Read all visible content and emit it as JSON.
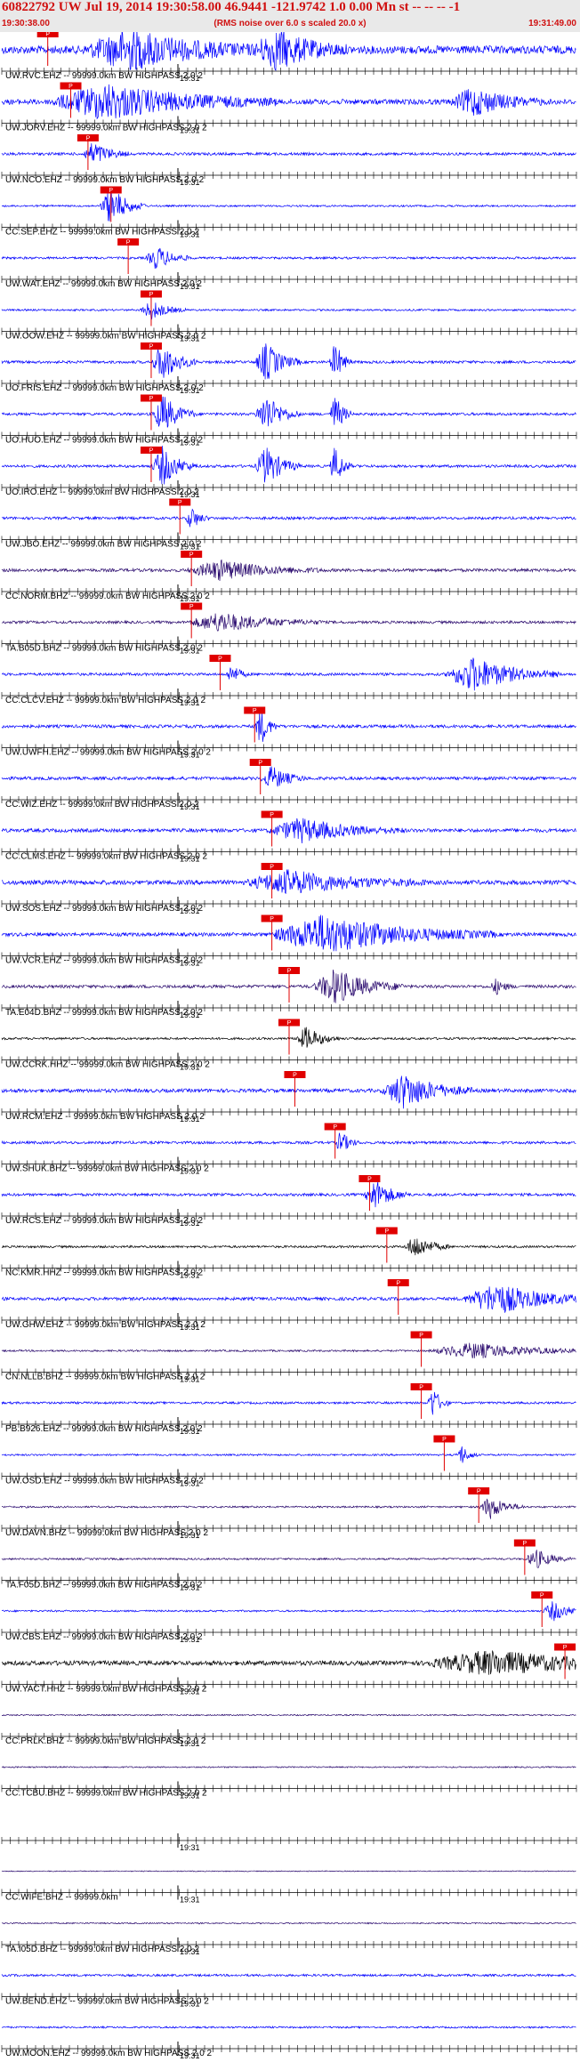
{
  "header": {
    "title": "60822792 UW Jul 19, 2014 19:30:58.00   46.9441 -121.9742  1.0 0.00 Mn st -- -- --  -1",
    "start_time": "19:30:38.00",
    "end_time": "19:31:49.00",
    "subtitle": "(RMS noise over 6.0 s scaled 20.0 x)"
  },
  "chart_data": {
    "type": "line",
    "title": "60822792 UW Jul 19, 2014 19:30:58.00   46.9441 -121.9742  1.0 0.00 Mn st -- -- --  -1",
    "subtitle": "(RMS noise over 6.0 s scaled 20.0 x)",
    "x_range": [
      "19:30:38.00",
      "19:31:49.00"
    ],
    "tick_label": "19:31",
    "pick_label": "P",
    "colors": {
      "blue": "#0000ff",
      "purple": "#2a0a6e",
      "black": "#000000",
      "pick": "#e00000"
    },
    "series": [
      {
        "label": "UW.RVC.EHZ -- 99999.0km BW  HIGHPASS  2.0  2",
        "color": "blue",
        "pick": 0.08,
        "amp": 0.9,
        "bursts": [
          [
            0.22,
            0.08,
            1.0
          ],
          [
            0.48,
            0.04,
            1.0
          ]
        ]
      },
      {
        "label": "UW.JORV.EHZ -- 99999.0km BW  HIGHPASS  2.0  2",
        "color": "blue",
        "pick": 0.12,
        "amp": 0.6,
        "bursts": [
          [
            0.18,
            0.1,
            0.9
          ],
          [
            0.82,
            0.04,
            0.7
          ]
        ]
      },
      {
        "label": "UW.NCO.EHZ -- 99999.0km BW  HIGHPASS  2.0  2",
        "color": "blue",
        "pick": 0.15,
        "amp": 0.3,
        "bursts": [
          [
            0.16,
            0.02,
            0.6
          ]
        ]
      },
      {
        "label": "CC.SEP.EHZ -- 99999.0km BW  HIGHPASS  2.0  2",
        "color": "blue",
        "pick": 0.19,
        "amp": 0.2,
        "bursts": [
          [
            0.19,
            0.02,
            1.0
          ]
        ]
      },
      {
        "label": "UW.WAT.EHZ -- 99999.0km BW  HIGHPASS  2.0  2",
        "color": "blue",
        "pick": 0.22,
        "amp": 0.25,
        "bursts": [
          [
            0.27,
            0.02,
            0.6
          ]
        ]
      },
      {
        "label": "UW.OOW.EHZ -- 99999.0km BW  HIGHPASS  2.0  2",
        "color": "blue",
        "pick": 0.26,
        "amp": 0.2,
        "bursts": [
          [
            0.26,
            0.02,
            0.5
          ]
        ]
      },
      {
        "label": "UO.FRIS.EHZ -- 99999.0km BW  HIGHPASS  2.0  2",
        "color": "blue",
        "pick": 0.26,
        "amp": 0.3,
        "bursts": [
          [
            0.28,
            0.02,
            1.0
          ],
          [
            0.46,
            0.02,
            1.0
          ],
          [
            0.58,
            0.01,
            1.0
          ]
        ]
      },
      {
        "label": "UO.HUO.EHZ -- 99999.0km BW  HIGHPASS  2.0  2",
        "color": "blue",
        "pick": 0.26,
        "amp": 0.3,
        "bursts": [
          [
            0.28,
            0.02,
            1.0
          ],
          [
            0.46,
            0.02,
            1.0
          ],
          [
            0.58,
            0.01,
            1.0
          ]
        ]
      },
      {
        "label": "UO.IRO.EHZ -- 99999.0km BW  HIGHPASS  2.0  2",
        "color": "blue",
        "pick": 0.26,
        "amp": 0.3,
        "bursts": [
          [
            0.28,
            0.02,
            1.0
          ],
          [
            0.46,
            0.02,
            1.0
          ],
          [
            0.58,
            0.01,
            1.0
          ]
        ]
      },
      {
        "label": "UW.JBO.EHZ -- 99999.0km BW  HIGHPASS  2.0  2",
        "color": "blue",
        "pick": 0.31,
        "amp": 0.3,
        "bursts": [
          [
            0.33,
            0.01,
            0.6
          ]
        ]
      },
      {
        "label": "CC.NORM.BHZ -- 99999.0km BW  HIGHPASS  2.0  2",
        "color": "purple",
        "pick": 0.33,
        "amp": 0.35,
        "bursts": [
          [
            0.38,
            0.06,
            0.5
          ]
        ]
      },
      {
        "label": "TA.B05D.BHZ -- 99999.0km BW  HIGHPASS  2.0  2",
        "color": "purple",
        "pick": 0.33,
        "amp": 0.3,
        "bursts": [
          [
            0.38,
            0.06,
            0.5
          ]
        ]
      },
      {
        "label": "CC.CLCV.EHZ -- 99999.0km BW  HIGHPASS  2.0  2",
        "color": "blue",
        "pick": 0.38,
        "amp": 0.3,
        "bursts": [
          [
            0.4,
            0.01,
            0.5
          ],
          [
            0.82,
            0.05,
            0.9
          ]
        ]
      },
      {
        "label": "UW.UWFH.EHZ -- 99999.0km BW  HIGHPASS  2.0  2",
        "color": "blue",
        "pick": 0.44,
        "amp": 0.35,
        "bursts": [
          [
            0.45,
            0.01,
            1.0
          ]
        ]
      },
      {
        "label": "CC.WIZ.EHZ -- 99999.0km BW  HIGHPASS  2.0  2",
        "color": "blue",
        "pick": 0.45,
        "amp": 0.35,
        "bursts": [
          [
            0.47,
            0.02,
            0.6
          ]
        ]
      },
      {
        "label": "CC.CLMS.EHZ -- 99999.0km BW  HIGHPASS  2.0  2",
        "color": "blue",
        "pick": 0.47,
        "amp": 0.4,
        "bursts": [
          [
            0.52,
            0.06,
            0.6
          ]
        ]
      },
      {
        "label": "UW.SOS.EHZ -- 99999.0km BW  HIGHPASS  2.0  2",
        "color": "blue",
        "pick": 0.47,
        "amp": 0.5,
        "bursts": [
          [
            0.5,
            0.08,
            0.6
          ]
        ]
      },
      {
        "label": "UW.VCR.EHZ -- 99999.0km BW  HIGHPASS  2.0  2",
        "color": "blue",
        "pick": 0.47,
        "amp": 0.4,
        "bursts": [
          [
            0.56,
            0.1,
            1.0
          ]
        ]
      },
      {
        "label": "TA.E04D.BHZ -- 99999.0km BW  HIGHPASS  2.0  2",
        "color": "purple",
        "pick": 0.5,
        "amp": 0.35,
        "bursts": [
          [
            0.58,
            0.04,
            0.9
          ],
          [
            0.86,
            0.01,
            0.4
          ]
        ]
      },
      {
        "label": "UW.CCRK.HHZ -- 99999.0km BW  HIGHPASS  2.0  2",
        "color": "black",
        "pick": 0.5,
        "amp": 0.25,
        "bursts": [
          [
            0.53,
            0.02,
            0.6
          ]
        ]
      },
      {
        "label": "UW.RCM.EHZ -- 99999.0km BW  HIGHPASS  2.0  2",
        "color": "blue",
        "pick": 0.51,
        "amp": 0.4,
        "bursts": [
          [
            0.7,
            0.04,
            0.9
          ]
        ]
      },
      {
        "label": "UW.SHUK.BHZ -- 99999.0km BW  HIGHPASS  2.0  2",
        "color": "blue",
        "pick": 0.58,
        "amp": 0.3,
        "bursts": [
          [
            0.59,
            0.01,
            0.6
          ]
        ]
      },
      {
        "label": "UW.RCS.EHZ -- 99999.0km BW  HIGHPASS  2.0  2",
        "color": "blue",
        "pick": 0.64,
        "amp": 0.3,
        "bursts": [
          [
            0.65,
            0.02,
            0.8
          ]
        ]
      },
      {
        "label": "NC.KMR.HHZ -- 99999.0km BW  HIGHPASS  2.0  2",
        "color": "black",
        "pick": 0.67,
        "amp": 0.25,
        "bursts": [
          [
            0.72,
            0.02,
            0.6
          ]
        ]
      },
      {
        "label": "UW.GHW.EHZ -- 99999.0km BW  HIGHPASS  2.0  2",
        "color": "blue",
        "pick": 0.69,
        "amp": 0.35,
        "bursts": [
          [
            0.86,
            0.06,
            0.8
          ]
        ]
      },
      {
        "label": "CN.NLLB.BHZ -- 99999.0km BW  HIGHPASS  2.0  2",
        "color": "purple",
        "pick": 0.73,
        "amp": 0.2,
        "bursts": [
          [
            0.82,
            0.08,
            0.4
          ]
        ]
      },
      {
        "label": "PB.B926.EHZ -- 99999.0km BW  HIGHPASS  2.0  2",
        "color": "blue",
        "pick": 0.73,
        "amp": 0.25,
        "bursts": [
          [
            0.75,
            0.01,
            0.8
          ]
        ]
      },
      {
        "label": "UW.OSD.EHZ -- 99999.0km BW  HIGHPASS  2.0  2",
        "color": "blue",
        "pick": 0.77,
        "amp": 0.2,
        "bursts": [
          [
            0.8,
            0.01,
            0.5
          ]
        ]
      },
      {
        "label": "UW.DAVN.BHZ -- 99999.0km BW  HIGHPASS  2.0  2",
        "color": "purple",
        "pick": 0.83,
        "amp": 0.2,
        "bursts": [
          [
            0.85,
            0.02,
            0.6
          ]
        ]
      },
      {
        "label": "TA.F05D.BHZ -- 99999.0km BW  HIGHPASS  2.0  2",
        "color": "purple",
        "pick": 0.91,
        "amp": 0.2,
        "bursts": [
          [
            0.93,
            0.02,
            0.5
          ]
        ]
      },
      {
        "label": "UW.CBS.EHZ -- 99999.0km BW  HIGHPASS  2.0  2",
        "color": "blue",
        "pick": 0.94,
        "amp": 0.2,
        "bursts": [
          [
            0.96,
            0.02,
            0.5
          ]
        ]
      },
      {
        "label": "UW.YACT.HHZ -- 99999.0km BW  HIGHPASS  2.0  2",
        "color": "black",
        "pick": 0.98,
        "amp": 0.5,
        "bursts": [
          [
            0.85,
            0.12,
            0.6
          ]
        ]
      },
      {
        "label": "CC.PRLK.BHZ -- 99999.0km BW  HIGHPASS  2.0  2",
        "color": "purple",
        "pick": null,
        "amp": 0.15,
        "bursts": []
      },
      {
        "label": "CC.TCBU.BHZ -- 99999.0km BW  HIGHPASS  2.0  2",
        "color": "purple",
        "pick": null,
        "amp": 0.15,
        "bursts": []
      },
      {
        "label": "",
        "color": "purple",
        "pick": null,
        "amp": 0.0,
        "bursts": []
      },
      {
        "label": "CC.WIFE.BHZ -- 99999.0km",
        "color": "purple",
        "pick": null,
        "amp": 0.1,
        "bursts": []
      },
      {
        "label": "TA.I05D.BHZ -- 99999.0km BW  HIGHPASS  2.0  2",
        "color": "purple",
        "pick": null,
        "amp": 0.15,
        "bursts": []
      },
      {
        "label": "UW.BEND.EHZ -- 99999.0km BW  HIGHPASS  2.0  2",
        "color": "blue",
        "pick": null,
        "amp": 0.25,
        "bursts": []
      },
      {
        "label": "UW.MOON.EHZ -- 99999.0km BW  HIGHPASS  2.0  2",
        "color": "blue",
        "pick": null,
        "amp": 0.2,
        "bursts": []
      }
    ]
  }
}
